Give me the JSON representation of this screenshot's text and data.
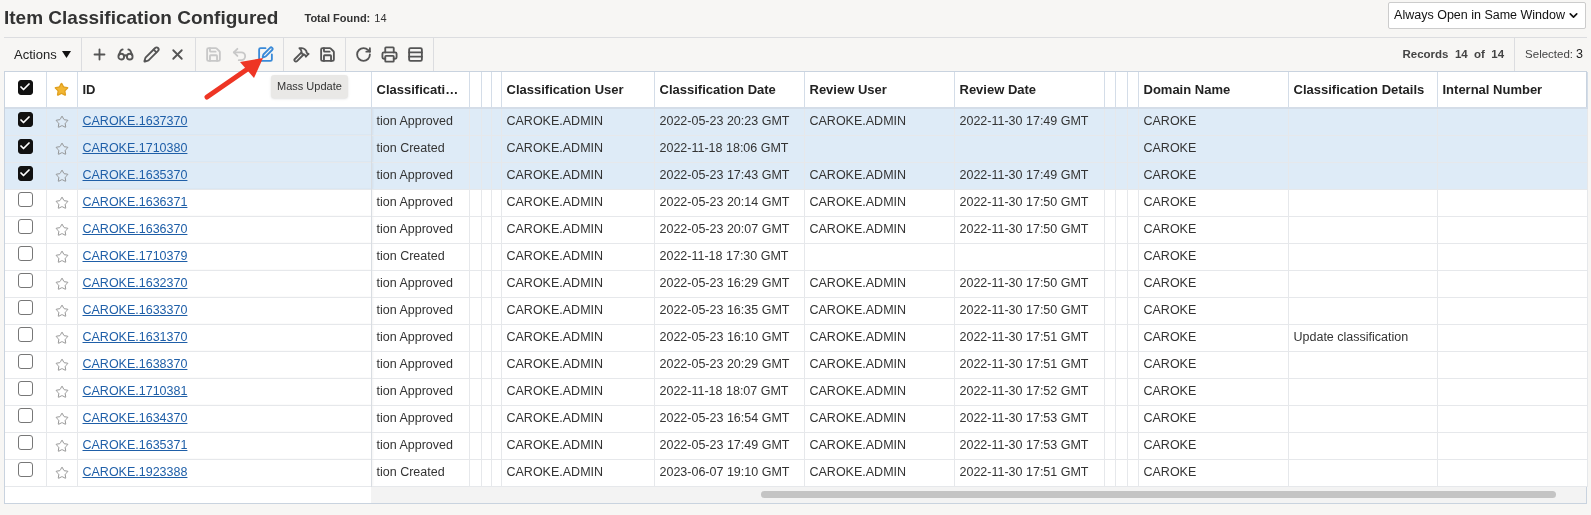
{
  "page": {
    "title": "Item Classification Configured",
    "total_label": "Total Found:",
    "total_value": "14"
  },
  "window_select": {
    "value": "Always Open in Same Window"
  },
  "toolbar": {
    "actions_label": "Actions",
    "groups": [
      [
        {
          "kind": "add",
          "disabled": false
        },
        {
          "kind": "view",
          "disabled": false
        },
        {
          "kind": "edit",
          "disabled": false
        },
        {
          "kind": "delete",
          "disabled": false
        }
      ],
      [
        {
          "kind": "save",
          "disabled": true
        },
        {
          "kind": "undo",
          "disabled": true
        },
        {
          "kind": "mass_update",
          "disabled": false
        }
      ],
      [
        {
          "kind": "tools",
          "disabled": false
        },
        {
          "kind": "save",
          "disabled": false
        }
      ],
      [
        {
          "kind": "refresh",
          "disabled": false
        },
        {
          "kind": "print",
          "disabled": false
        },
        {
          "kind": "rows",
          "disabled": false
        }
      ]
    ],
    "records": "Records  14  of  14",
    "selected_label": "Selected:",
    "selected_value": "3"
  },
  "tooltip": "Mass Update",
  "table": {
    "select_all": {
      "checked": true
    },
    "columns": [
      "ID",
      "Classificati…",
      "Classification User",
      "Classification Date",
      "Review User",
      "Review Date",
      "Domain Name",
      "Classification Details",
      "Internal Number"
    ],
    "rows": [
      {
        "selected": true,
        "id": "CAROKE.1637370",
        "classification": "tion Approved",
        "classification_user": "CAROKE.ADMIN",
        "classification_date": "2022-05-23 20:23 GMT",
        "review_user": "CAROKE.ADMIN",
        "review_date": "2022-11-30 17:49 GMT",
        "domain": "CAROKE"
      },
      {
        "selected": true,
        "id": "CAROKE.1710380",
        "classification": "tion Created",
        "classification_user": "CAROKE.ADMIN",
        "classification_date": "2022-11-18 18:06 GMT",
        "domain": "CAROKE"
      },
      {
        "selected": true,
        "id": "CAROKE.1635370",
        "classification": "tion Approved",
        "classification_user": "CAROKE.ADMIN",
        "classification_date": "2022-05-23 17:43 GMT",
        "review_user": "CAROKE.ADMIN",
        "review_date": "2022-11-30 17:49 GMT",
        "domain": "CAROKE"
      },
      {
        "selected": false,
        "id": "CAROKE.1636371",
        "classification": "tion Approved",
        "classification_user": "CAROKE.ADMIN",
        "classification_date": "2022-05-23 20:14 GMT",
        "review_user": "CAROKE.ADMIN",
        "review_date": "2022-11-30 17:50 GMT",
        "domain": "CAROKE"
      },
      {
        "selected": false,
        "id": "CAROKE.1636370",
        "classification": "tion Approved",
        "classification_user": "CAROKE.ADMIN",
        "classification_date": "2022-05-23 20:07 GMT",
        "review_user": "CAROKE.ADMIN",
        "review_date": "2022-11-30 17:50 GMT",
        "domain": "CAROKE"
      },
      {
        "selected": false,
        "id": "CAROKE.1710379",
        "classification": "tion Created",
        "classification_user": "CAROKE.ADMIN",
        "classification_date": "2022-11-18 17:30 GMT",
        "domain": "CAROKE"
      },
      {
        "selected": false,
        "id": "CAROKE.1632370",
        "classification": "tion Approved",
        "classification_user": "CAROKE.ADMIN",
        "classification_date": "2022-05-23 16:29 GMT",
        "review_user": "CAROKE.ADMIN",
        "review_date": "2022-11-30 17:50 GMT",
        "domain": "CAROKE"
      },
      {
        "selected": false,
        "id": "CAROKE.1633370",
        "classification": "tion Approved",
        "classification_user": "CAROKE.ADMIN",
        "classification_date": "2022-05-23 16:35 GMT",
        "review_user": "CAROKE.ADMIN",
        "review_date": "2022-11-30 17:50 GMT",
        "domain": "CAROKE"
      },
      {
        "selected": false,
        "id": "CAROKE.1631370",
        "classification": "tion Approved",
        "classification_user": "CAROKE.ADMIN",
        "classification_date": "2022-05-23 16:10 GMT",
        "review_user": "CAROKE.ADMIN",
        "review_date": "2022-11-30 17:51 GMT",
        "domain": "CAROKE",
        "details": "Update classification"
      },
      {
        "selected": false,
        "id": "CAROKE.1638370",
        "classification": "tion Approved",
        "classification_user": "CAROKE.ADMIN",
        "classification_date": "2022-05-23 20:29 GMT",
        "review_user": "CAROKE.ADMIN",
        "review_date": "2022-11-30 17:51 GMT",
        "domain": "CAROKE"
      },
      {
        "selected": false,
        "id": "CAROKE.1710381",
        "classification": "tion Approved",
        "classification_user": "CAROKE.ADMIN",
        "classification_date": "2022-11-18 18:07 GMT",
        "review_user": "CAROKE.ADMIN",
        "review_date": "2022-11-30 17:52 GMT",
        "domain": "CAROKE"
      },
      {
        "selected": false,
        "id": "CAROKE.1634370",
        "classification": "tion Approved",
        "classification_user": "CAROKE.ADMIN",
        "classification_date": "2022-05-23 16:54 GMT",
        "review_user": "CAROKE.ADMIN",
        "review_date": "2022-11-30 17:53 GMT",
        "domain": "CAROKE"
      },
      {
        "selected": false,
        "id": "CAROKE.1635371",
        "classification": "tion Approved",
        "classification_user": "CAROKE.ADMIN",
        "classification_date": "2022-05-23 17:49 GMT",
        "review_user": "CAROKE.ADMIN",
        "review_date": "2022-11-30 17:53 GMT",
        "domain": "CAROKE"
      },
      {
        "selected": false,
        "id": "CAROKE.1923388",
        "classification": "tion Created",
        "classification_user": "CAROKE.ADMIN",
        "classification_date": "2023-06-07 19:10 GMT",
        "review_user": "CAROKE.ADMIN",
        "review_date": "2022-11-30 17:51 GMT",
        "domain": "CAROKE"
      }
    ]
  }
}
